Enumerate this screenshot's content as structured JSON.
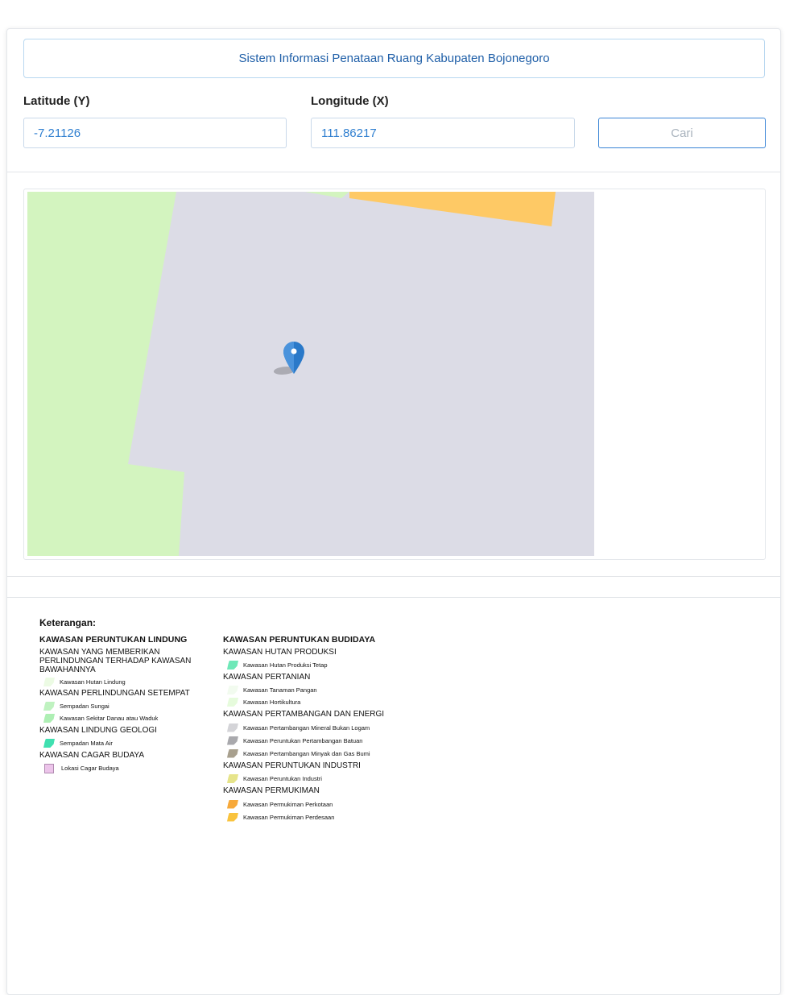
{
  "header": {
    "title": "Sistem Informasi Penataan Ruang Kabupaten Bojonegoro"
  },
  "form": {
    "lat_label": "Latitude (Y)",
    "lat_value": "-7.21126",
    "lon_label": "Longitude (X)",
    "lon_value": "111.86217",
    "search_label": "Cari"
  },
  "map": {
    "colors": {
      "base": "#dcdce6",
      "green": "#d3f4bf",
      "orange": "#fec965",
      "marker": "#2a79c9"
    },
    "marker_icon": "map-pin-icon"
  },
  "legend": {
    "heading": "Keterangan:",
    "left": {
      "title": "KAWASAN PERUNTUKAN LINDUNG",
      "g1": "KAWASAN YANG MEMBERIKAN PERLINDUNGAN TERHADAP KAWASAN BAWAHANNYA",
      "g1_i1": "Kawasan Hutan Lindung",
      "g2": "KAWASAN PERLINDUNGAN SETEMPAT",
      "g2_i1": "Sempadan Sungai",
      "g2_i2": "Kawasan Sekitar Danau atau Waduk",
      "g3": "KAWASAN LINDUNG GEOLOGI",
      "g3_i1": "Sempadan Mata Air",
      "g4": "KAWASAN CAGAR BUDAYA",
      "g4_i1": "Lokasi Cagar Budaya"
    },
    "right": {
      "title": "KAWASAN PERUNTUKAN BUDIDAYA",
      "g1": "KAWASAN HUTAN PRODUKSI",
      "g1_i1": "Kawasan Hutan Produksi Tetap",
      "g2": "KAWASAN PERTANIAN",
      "g2_i1": "Kawasan Tanaman Pangan",
      "g2_i2": "Kawasan Hortikultura",
      "g3": "KAWASAN PERTAMBANGAN DAN ENERGI",
      "g3_i1": "Kawasan Pertambangan Mineral Bukan Logam",
      "g3_i2": "Kawasan Peruntukan Pertambangan Batuan",
      "g3_i3": "Kawasan Pertambangan Minyak dan Gas Bumi",
      "g4": "KAWASAN PERUNTUKAN INDUSTRI",
      "g4_i1": "Kawasan Peruntukan Industri",
      "g5": "KAWASAN PERMUKIMAN",
      "g5_i1": "Kawasan Permukiman Perkotaan",
      "g5_i2": "Kawasan Permukiman Perdesaan"
    }
  }
}
